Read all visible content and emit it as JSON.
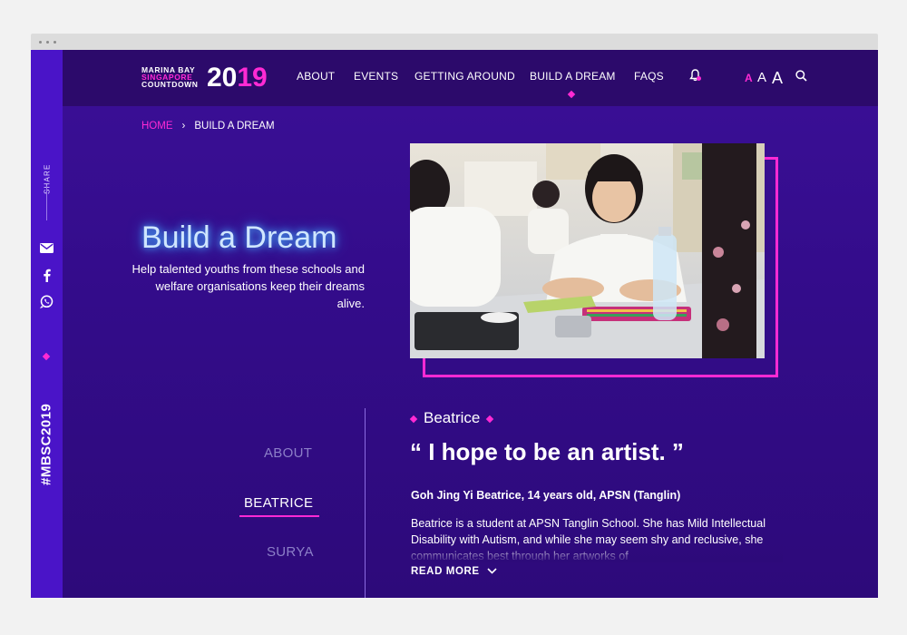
{
  "header": {
    "logo": {
      "line1": "MARINA BAY",
      "line2": "SINGAPORE",
      "line3": "COUNTDOWN",
      "year_a": "20",
      "year_b": "19"
    },
    "nav": [
      "ABOUT",
      "EVENTS",
      "GETTING AROUND",
      "BUILD A DREAM",
      "FAQS"
    ],
    "active_nav": "BUILD A DREAM",
    "font_size_labels": [
      "A",
      "A",
      "A"
    ],
    "icons": {
      "notifications": "bell-icon",
      "search": "search-icon"
    },
    "colors": {
      "accent": "#ff2ad4",
      "header_bg": "#2c0a6b",
      "rail_bg": "#4a14c8"
    }
  },
  "share_rail": {
    "label": "SHARE",
    "icons": [
      "email-icon",
      "facebook-icon",
      "whatsapp-icon"
    ],
    "hashtag": "#MBSC2019"
  },
  "breadcrumb": {
    "home": "HOME",
    "separator": "›",
    "current": "BUILD A DREAM"
  },
  "hero": {
    "title": "Build a Dream",
    "subtitle": "Help talented youths from these schools and welfare organisations keep their dreams alive."
  },
  "side_nav": {
    "items": [
      "ABOUT",
      "BEATRICE",
      "SURYA"
    ],
    "active": "BEATRICE"
  },
  "profile": {
    "name": "Beatrice",
    "quote": "“ I hope to be an artist. ”",
    "byline": "Goh Jing Yi Beatrice, 14 years old, APSN (Tanglin)",
    "bio": "Beatrice is a student at APSN Tanglin School. She has Mild Intellectual Disability with Autism, and while she may seem shy and reclusive, she communicates best through her artworks of",
    "read_more": "READ MORE"
  }
}
